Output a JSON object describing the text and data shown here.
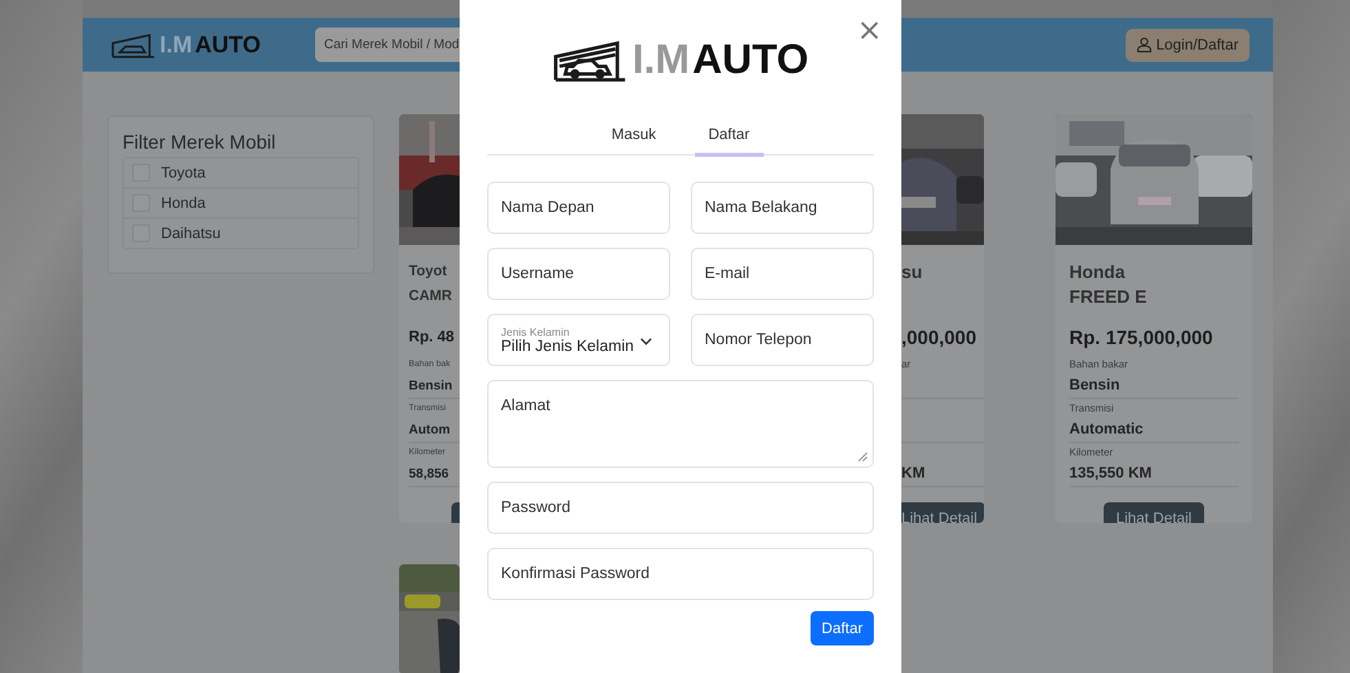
{
  "header": {
    "logo": {
      "prefix": "I.M",
      "name": "AUTO"
    },
    "search": {
      "placeholder": "Cari Merek Mobil / Mod"
    },
    "login_button": "Login/Daftar"
  },
  "filter": {
    "title": "Filter Merek Mobil",
    "brands": [
      {
        "label": "Toyota",
        "checked": false
      },
      {
        "label": "Honda",
        "checked": false
      },
      {
        "label": "Daihatsu",
        "checked": false
      }
    ]
  },
  "cards": [
    {
      "kind": "left",
      "brand": "Toyot",
      "model": "CAMR",
      "price": "Rp. 48",
      "fuel_label": "Bahan bak",
      "fuel": "Bensin",
      "transmission_label": "Transmisi",
      "transmission": "Autom",
      "km_label": "Kilometer",
      "km": "58,856"
    },
    {
      "kind": "right",
      "brand": "su",
      "price": ",000,000",
      "fuel_label": "ar",
      "km": "KM",
      "button": "Lihat Detail"
    },
    {
      "kind": "full",
      "brand": "Honda",
      "model": "FREED E",
      "price": "Rp. 175,000,000",
      "fuel_label": "Bahan bakar",
      "fuel": "Bensin",
      "transmission_label": "Transmisi",
      "transmission": "Automatic",
      "km_label": "Kilometer",
      "km": "135,550 KM",
      "button": "Lihat Detail"
    }
  ],
  "modal": {
    "close": "×",
    "logo": {
      "prefix": "I.M",
      "name": "AUTO"
    },
    "tabs": [
      {
        "label": "Masuk",
        "selected": false
      },
      {
        "label": "Daftar",
        "selected": true
      }
    ],
    "fields": [
      {
        "kind": "input",
        "placeholder": "Nama Depan",
        "half": true
      },
      {
        "kind": "input",
        "placeholder": "Nama Belakang",
        "half": true
      },
      {
        "kind": "input",
        "placeholder": "Username",
        "half": true
      },
      {
        "kind": "input",
        "placeholder": "E-mail",
        "half": true
      },
      {
        "kind": "select",
        "label": "Jenis Kelamin",
        "value": "Pilih Jenis Kelamin",
        "half": true
      },
      {
        "kind": "input",
        "placeholder": "Nomor Telepon",
        "half": true
      },
      {
        "kind": "textarea",
        "placeholder": "Alamat",
        "half": false
      },
      {
        "kind": "input",
        "placeholder": "Password",
        "half": false
      },
      {
        "kind": "input",
        "placeholder": "Konfirmasi Password",
        "half": false
      }
    ],
    "submit": "Daftar"
  }
}
